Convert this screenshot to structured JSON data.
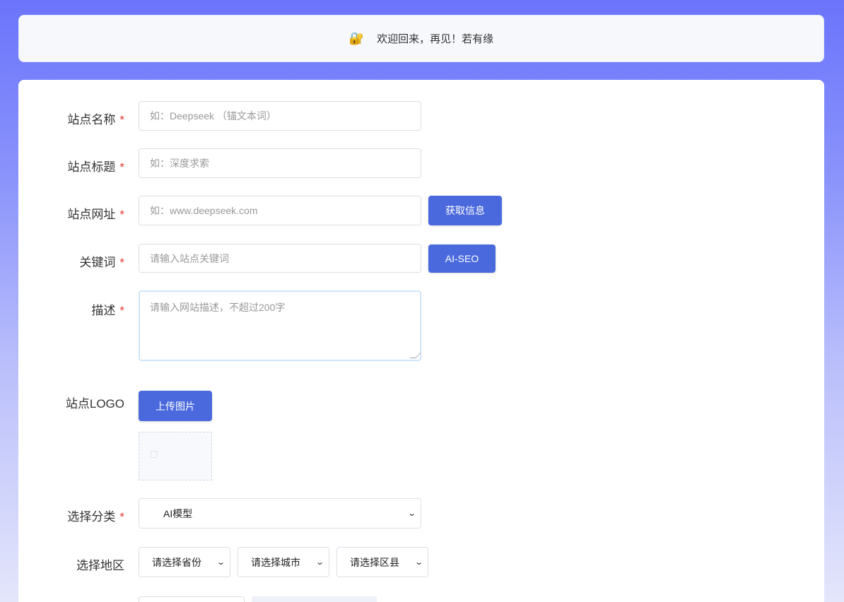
{
  "notice": {
    "icon": "lock-icon",
    "text": "欢迎回来，再见！若有缘"
  },
  "form": {
    "site_name": {
      "label": "站点名称",
      "placeholder": "如：Deepseek （锚文本词）"
    },
    "site_title": {
      "label": "站点标题",
      "placeholder": "如：深度求索"
    },
    "site_url": {
      "label": "站点网址",
      "placeholder": "如：www.deepseek.com",
      "button": "获取信息"
    },
    "keywords": {
      "label": "关键词",
      "placeholder": "请输入站点关键词",
      "button": "AI-SEO"
    },
    "description": {
      "label": "描述",
      "placeholder": "请输入网站描述，不超过200字"
    },
    "logo": {
      "label": "站点LOGO",
      "button": "上传图片"
    },
    "category": {
      "label": "选择分类",
      "value": "AI模型"
    },
    "region": {
      "label": "选择地区",
      "province": "请选择省份",
      "city": "请选择城市",
      "district": "请选择区县"
    },
    "required_mark": "*"
  },
  "colors": {
    "primary": "#4a69dd",
    "required": "#e53935"
  }
}
